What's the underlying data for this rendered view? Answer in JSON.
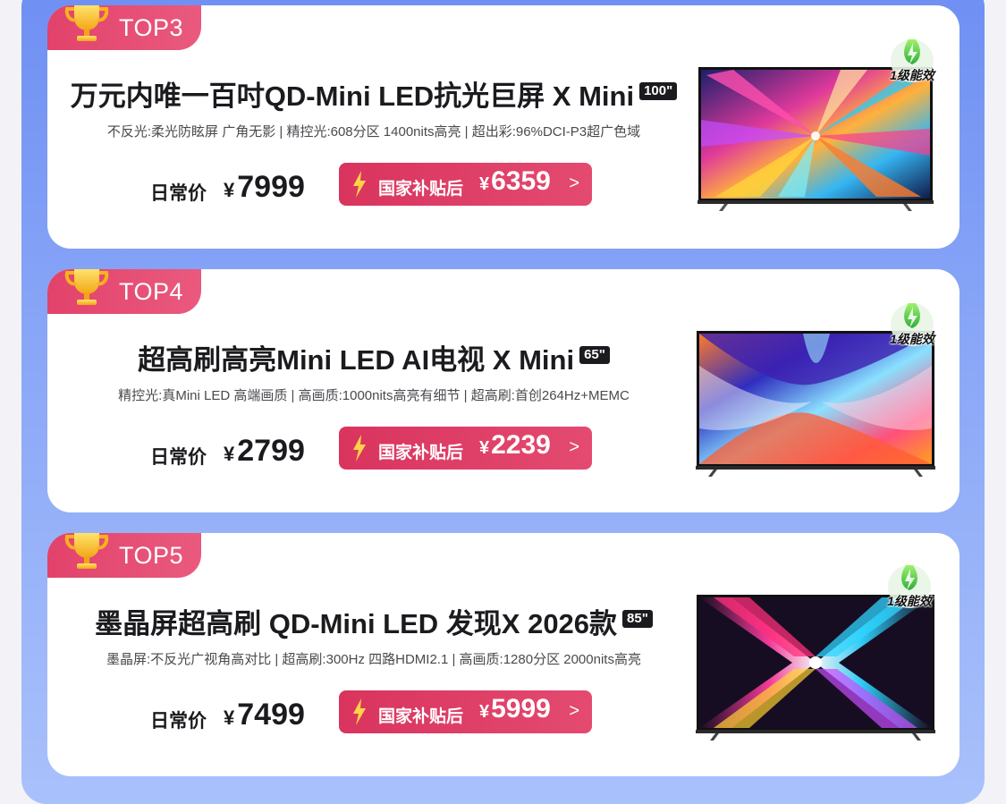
{
  "colors": {
    "accent": "#e2426b",
    "panel": "#7d9cf5",
    "text": "#1b1b1f"
  },
  "products": [
    {
      "rank": "TOP3",
      "title": "万元内唯一百吋QD-Mini LED抗光巨屏 X Mini",
      "size": "100\"",
      "specs": "不反光:柔光防眩屏  广角无影 | 精控光:608分区  1400nits高亮 |   超出彩:96%DCI-P3超广色域",
      "daily_label": "日常价",
      "currency": "¥",
      "daily_price": "7999",
      "subsidy_label": "国家补贴后",
      "subsidy_price": "6359",
      "chevron": ">",
      "energy_label": "1级能效",
      "icons": [
        "trophy-icon",
        "bolt-icon",
        "energy-label-icon"
      ]
    },
    {
      "rank": "TOP4",
      "title": "超高刷高亮Mini LED AI电视 X Mini",
      "size": "65\"",
      "specs": "精控光:真Mini LED  高端画质 | 高画质:1000nits高亮有细节 | 超高刷:首创264Hz+MEMC",
      "daily_label": "日常价",
      "currency": "¥",
      "daily_price": "2799",
      "subsidy_label": "国家补贴后",
      "subsidy_price": "2239",
      "chevron": ">",
      "energy_label": "1级能效",
      "icons": [
        "trophy-icon",
        "bolt-icon",
        "energy-label-icon"
      ]
    },
    {
      "rank": "TOP5",
      "title": "墨晶屏超高刷 QD-Mini LED 发现X 2026款",
      "size": "85\"",
      "specs": "墨晶屏:不反光广视角高对比  | 超高刷:300Hz  四路HDMI2.1 | 高画质:1280分区  2000nits高亮",
      "daily_label": "日常价",
      "currency": "¥",
      "daily_price": "7499",
      "subsidy_label": "国家补贴后",
      "subsidy_price": "5999",
      "chevron": ">",
      "energy_label": "1级能效",
      "icons": [
        "trophy-icon",
        "bolt-icon",
        "energy-label-icon"
      ]
    }
  ]
}
